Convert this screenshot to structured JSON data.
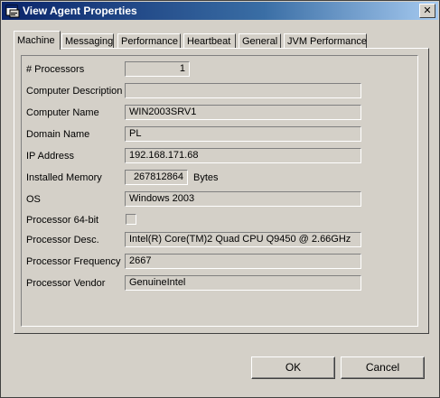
{
  "window": {
    "title": "View Agent Properties",
    "close_glyph": "✕"
  },
  "tabs": [
    {
      "label": "Machine",
      "active": true
    },
    {
      "label": "Messaging",
      "active": false
    },
    {
      "label": "Performance",
      "active": false
    },
    {
      "label": "Heartbeat",
      "active": false
    },
    {
      "label": "General",
      "active": false
    },
    {
      "label": "JVM Performance",
      "active": false
    }
  ],
  "fields": {
    "processors": {
      "label": "# Processors",
      "value": "1"
    },
    "computer_description": {
      "label": "Computer Description",
      "value": ""
    },
    "computer_name": {
      "label": "Computer Name",
      "value": "WIN2003SRV1"
    },
    "domain_name": {
      "label": "Domain Name",
      "value": "PL"
    },
    "ip_address": {
      "label": "IP Address",
      "value": "192.168.171.68"
    },
    "installed_memory": {
      "label": "Installed Memory",
      "value": "267812864",
      "unit": "Bytes"
    },
    "os": {
      "label": "OS",
      "value": "Windows 2003"
    },
    "processor_64bit": {
      "label": "Processor 64-bit",
      "checked": false
    },
    "processor_desc": {
      "label": "Processor Desc.",
      "value": "Intel(R) Core(TM)2 Quad  CPU   Q9450  @ 2.66GHz"
    },
    "processor_frequency": {
      "label": "Processor Frequency",
      "value": "2667"
    },
    "processor_vendor": {
      "label": "Processor Vendor",
      "value": "GenuineIntel"
    }
  },
  "buttons": {
    "ok": "OK",
    "cancel": "Cancel"
  },
  "colors": {
    "titlebar_start": "#0a246a",
    "titlebar_end": "#a6caf0",
    "face": "#d4d0c8"
  }
}
